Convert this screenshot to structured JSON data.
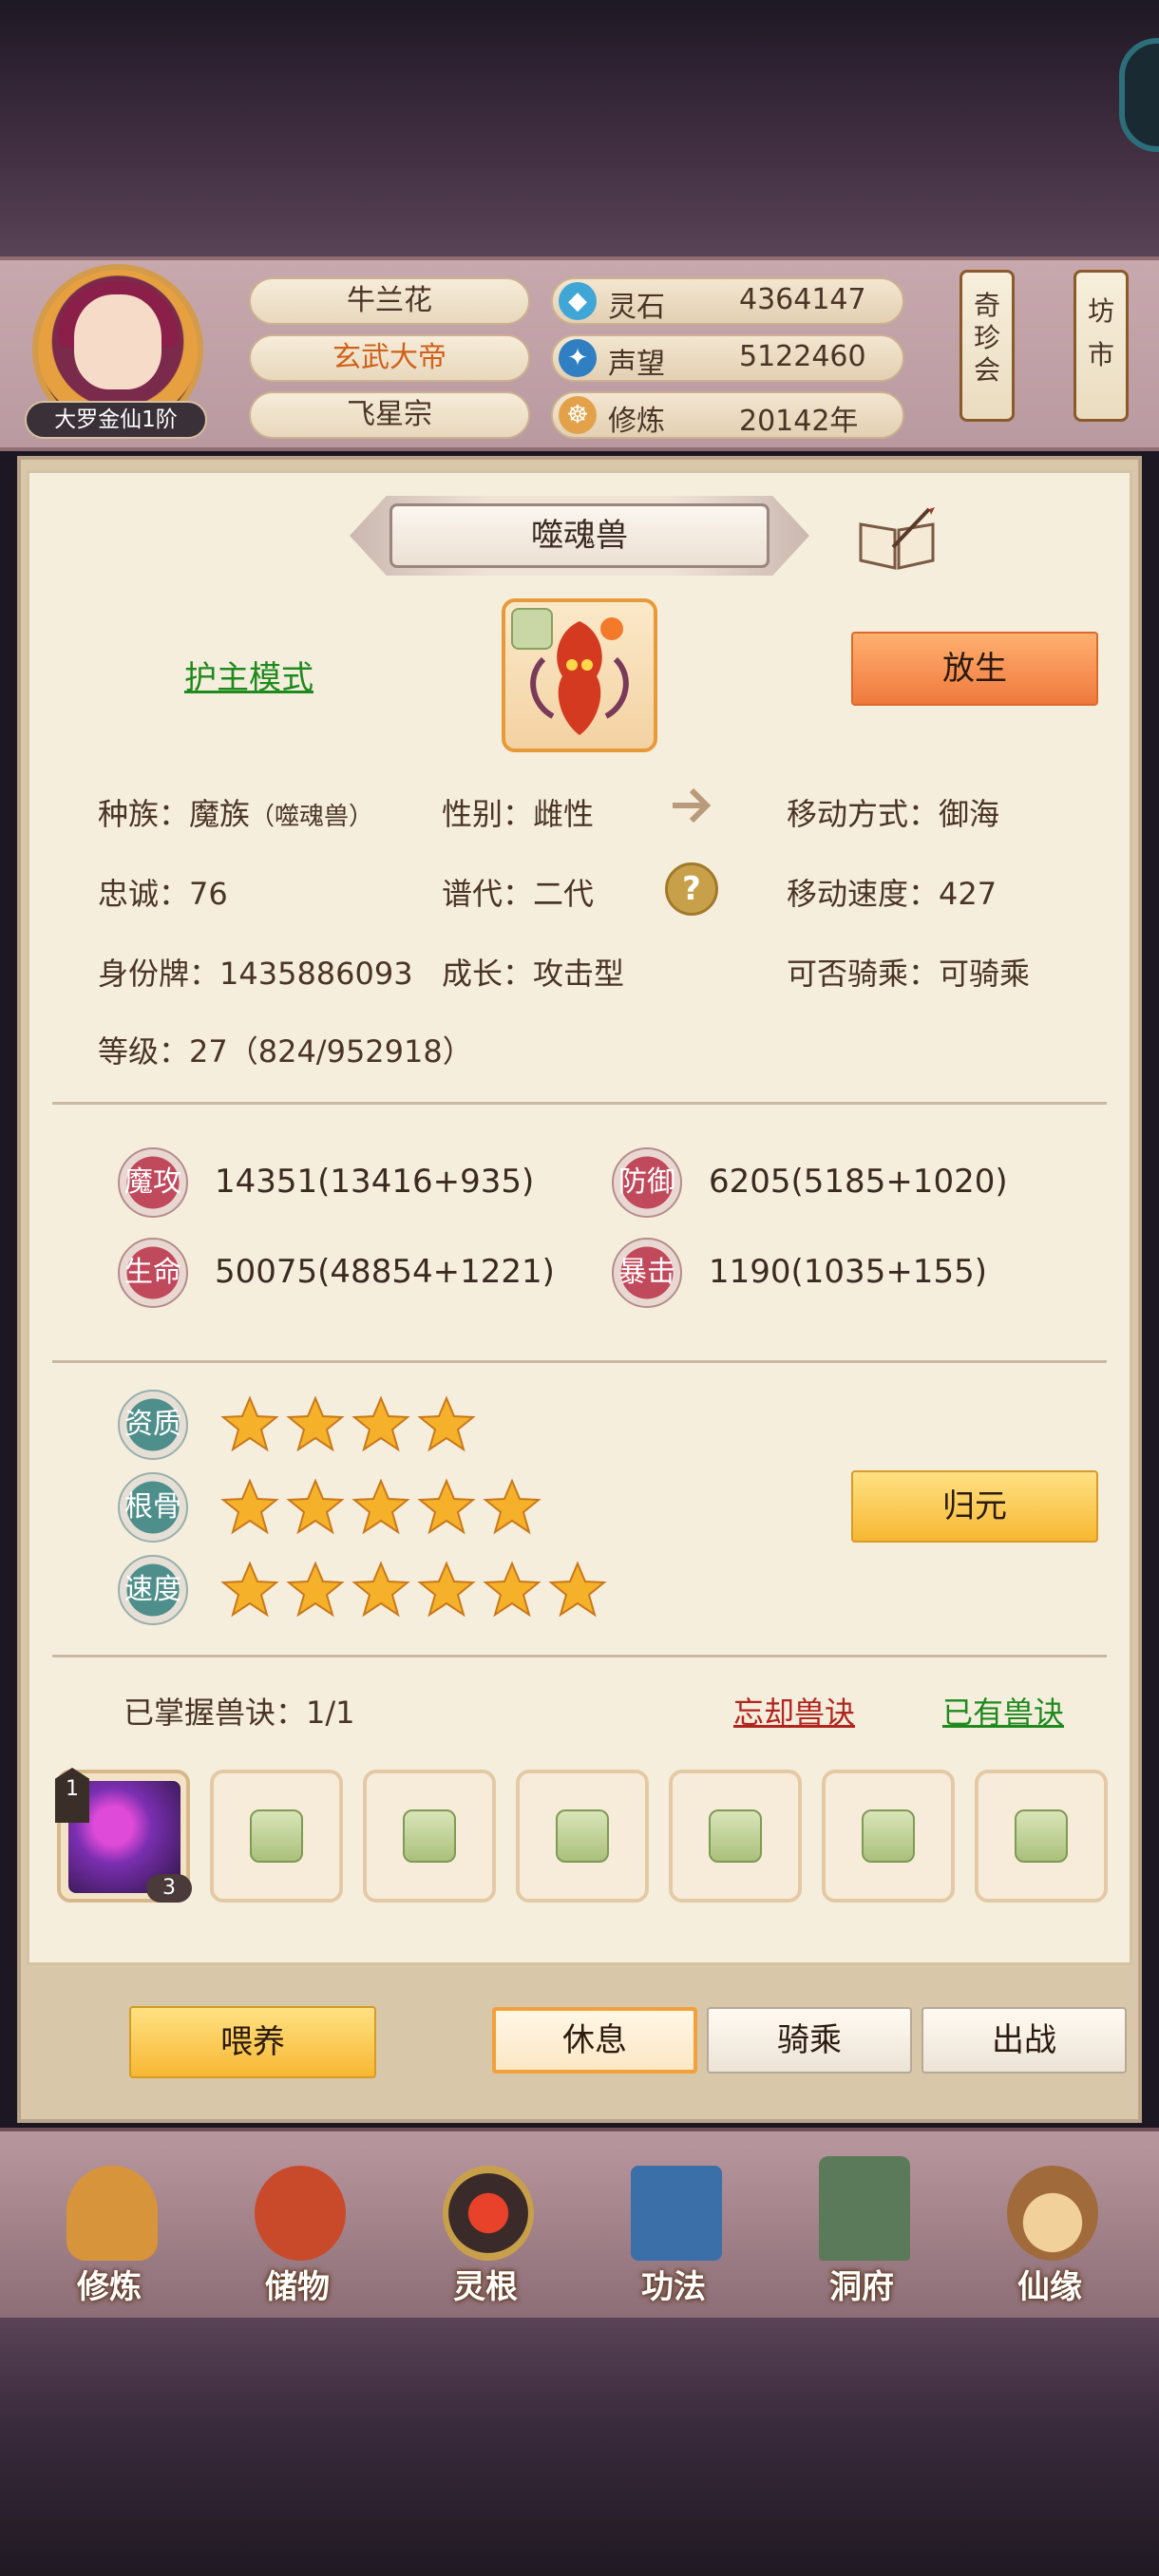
{
  "player": {
    "rank": "大罗金仙1阶",
    "name": "牛兰花",
    "title": "玄武大帝",
    "sect": "飞星宗"
  },
  "resources": [
    {
      "icon": "spirit-stone-icon",
      "label": "灵石",
      "value": "4364147"
    },
    {
      "icon": "prestige-icon",
      "label": "声望",
      "value": "5122460"
    },
    {
      "icon": "cultivation-icon",
      "label": "修炼",
      "value": "20142年"
    }
  ],
  "side_buttons": {
    "treasure_fair": "奇珍会",
    "market": "坊市"
  },
  "pet": {
    "name": "噬魂兽",
    "mode_label": "护主模式",
    "release_label": "放生",
    "race_label": "种族：",
    "race": "魔族",
    "race_sub": "（噬魂兽）",
    "gender": "性别：雌性",
    "movement_type": "移动方式：御海",
    "loyalty": "忠诚：76",
    "generation": "谱代：二代",
    "move_speed": "移动速度：427",
    "id_tag": "身份牌：1435886093",
    "growth": "成长：攻击型",
    "rideable": "可否骑乘：可骑乘",
    "level": "等级：27（824/952918）"
  },
  "stats": [
    {
      "label": "魔攻",
      "value": "14351(13416+935)"
    },
    {
      "label": "防御",
      "value": "6205(5185+1020)"
    },
    {
      "label": "生命",
      "value": "50075(48854+1221)"
    },
    {
      "label": "暴击",
      "value": "1190(1035+155)"
    }
  ],
  "qualities": [
    {
      "label": "资质",
      "stars": 4
    },
    {
      "label": "根骨",
      "stars": 5
    },
    {
      "label": "速度",
      "stars": 6
    }
  ],
  "reset_label": "归元",
  "skills": {
    "mastered": "已掌握兽诀：1/1",
    "forget": "忘却兽诀",
    "owned": "已有兽诀",
    "first_slot_tier": "1",
    "first_slot_count": "3"
  },
  "actions": {
    "feed": "喂养",
    "rest": "休息",
    "ride": "骑乘",
    "battle": "出战"
  },
  "nav": [
    "修炼",
    "储物",
    "灵根",
    "功法",
    "洞府",
    "仙缘"
  ],
  "colors": {
    "accent_orange": "#f0793d",
    "accent_yellow": "#f7b832",
    "link_green": "#1e8a1e",
    "link_red": "#b0261e"
  }
}
